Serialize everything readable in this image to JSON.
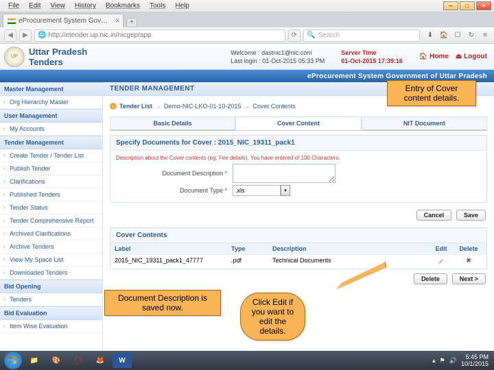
{
  "browser": {
    "menu": [
      "File",
      "Edit",
      "View",
      "History",
      "Bookmarks",
      "Tools",
      "Help"
    ],
    "tab_title": "eProcurement System Gov…",
    "url": "http://etender.up.nic.in/nicgep/app",
    "search_placeholder": "Search"
  },
  "header": {
    "site_title_l1": "Uttar Pradesh",
    "site_title_l2": "Tenders",
    "welcome_label": "Welcome",
    "lastlogin_label": "Last login",
    "welcome_value": ": dastnic1@nic.com",
    "lastlogin_value": ": 01-Oct-2015 05:33 PM",
    "server_label": "Server Time",
    "server_value": "01-Oct-2015 17:39:16",
    "home": "Home",
    "logout": "Logout",
    "blue_band": "eProcurement System Government of Uttar Pradesh"
  },
  "sidebar": {
    "groups": [
      {
        "title": "Master Management",
        "items": [
          "Org Hierarchy Master"
        ]
      },
      {
        "title": "User Management",
        "items": [
          "My Accounts"
        ]
      },
      {
        "title": "Tender Management",
        "items": [
          "Create Tender / Tender List",
          "Publish Tender",
          "Clarifications",
          "Published Tenders",
          "Tender Status",
          "Tender Comprehensive Report",
          "Archived Clarifications",
          "Archive Tenders",
          "View My Space List",
          "Downloaded Tenders"
        ]
      },
      {
        "title": "Bid Opening",
        "items": [
          "Tenders"
        ]
      },
      {
        "title": "Bid Evaluation",
        "items": [
          "Item Wise Evaluation"
        ]
      }
    ]
  },
  "page": {
    "title": "TENDER MANAGEMENT",
    "breadcrumb": [
      "Tender List",
      "Demo-NIC-LKO-01-10-2015",
      "Cover Contents"
    ],
    "tabs": [
      "Basic Details",
      "Cover Content",
      "NIT Document"
    ],
    "active_tab": 1,
    "panel_title": "Specify Documents for Cover : 2015_NIC_19311_pack1",
    "hint": "Description about the Cover contents (eg: Fee details). You have entered   of 100 Characters.",
    "label_desc": "Document Description",
    "label_type": "Document Type",
    "type_value": ".xls",
    "star": "*",
    "btn_cancel": "Cancel",
    "btn_save": "Save",
    "cover_title": "Cover Contents",
    "cols": {
      "label": "Label",
      "type": "Type",
      "desc": "Description",
      "edit": "Edit",
      "del": "Delete"
    },
    "row": {
      "label": "2015_NIC_19311_pack1_47777",
      "type": ".pdf",
      "desc": "Technical Documents"
    },
    "btn_delete": "Delete",
    "btn_next": "Next >"
  },
  "callouts": {
    "top": "Entry of Cover content details.",
    "left": "Document Description is saved now.",
    "bubble": "Click Edit if you want to edit the details."
  },
  "taskbar": {
    "time": "5:45 PM",
    "date": "10/1/2015"
  }
}
